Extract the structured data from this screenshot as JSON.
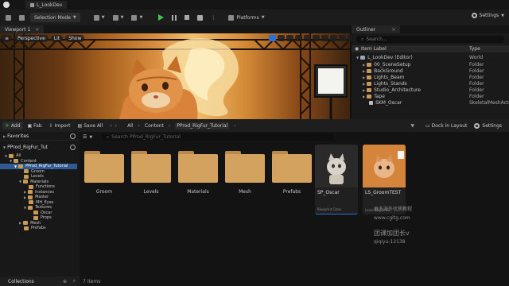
{
  "menu": {
    "level_tab": "L_LookDev"
  },
  "toolbar": {
    "mode_label": "Selection Mode",
    "platforms_label": "Platforms",
    "settings_label": "Settings"
  },
  "viewport": {
    "tab_label": "Viewport 1",
    "perspective_label": "Perspective",
    "lit_label": "Lit",
    "show_label": "Show"
  },
  "outliner": {
    "tab_label": "Outliner",
    "search_placeholder": "Search...",
    "col_item_label": "Item Label",
    "col_type": "Type",
    "rows": [
      {
        "label": "L_LookDev (Editor)",
        "type": "World"
      },
      {
        "label": "00_SceneSetup",
        "type": "Folder"
      },
      {
        "label": "BackGround",
        "type": "Folder"
      },
      {
        "label": "Lights_Beam",
        "type": "Folder"
      },
      {
        "label": "Lights_Stands",
        "type": "Folder"
      },
      {
        "label": "Studio_Architecture",
        "type": "Folder"
      },
      {
        "label": "Tape",
        "type": "Folder"
      },
      {
        "label": "SKM_Oscar",
        "type": "SkeletalMeshActor"
      }
    ]
  },
  "content_browser": {
    "add_label": "Add",
    "fab_label": "Fab",
    "import_label": "Import",
    "save_all_label": "Save All",
    "breadcrumb": [
      "All",
      "Content",
      "PProd_RigFur_Tutorial"
    ],
    "dock_label": "Dock in Layout",
    "settings_label": "Settings",
    "favorites_label": "Favorites",
    "project_label": "PProd_RigFur_Tut",
    "search_placeholder": "Search PProd_RigFur_Tutorial",
    "tree": [
      "All",
      "Content",
      "PProd_RigFur_Tutorial",
      "Groom",
      "Levels",
      "Materials",
      "Functions",
      "Instances",
      "Master",
      "MH_Eyes",
      "Textures",
      "Oscar",
      "Props",
      "Mesh",
      "Prefabs"
    ],
    "folders": [
      "Groom",
      "Levels",
      "Materials",
      "Mesh",
      "Prefabs"
    ],
    "assets": [
      {
        "name": "SP_Oscar",
        "type": "Blueprint Class"
      },
      {
        "name": "LS_GroomTEST",
        "type": "Level Sequence"
      }
    ],
    "items_count": "7 items",
    "collections_label": "Collections"
  },
  "watermark": {
    "line1": "更多海外优质教程",
    "line2": "www.cgltg.com",
    "line3": "团课加团长v",
    "line4": "qiqiyu-12138"
  }
}
